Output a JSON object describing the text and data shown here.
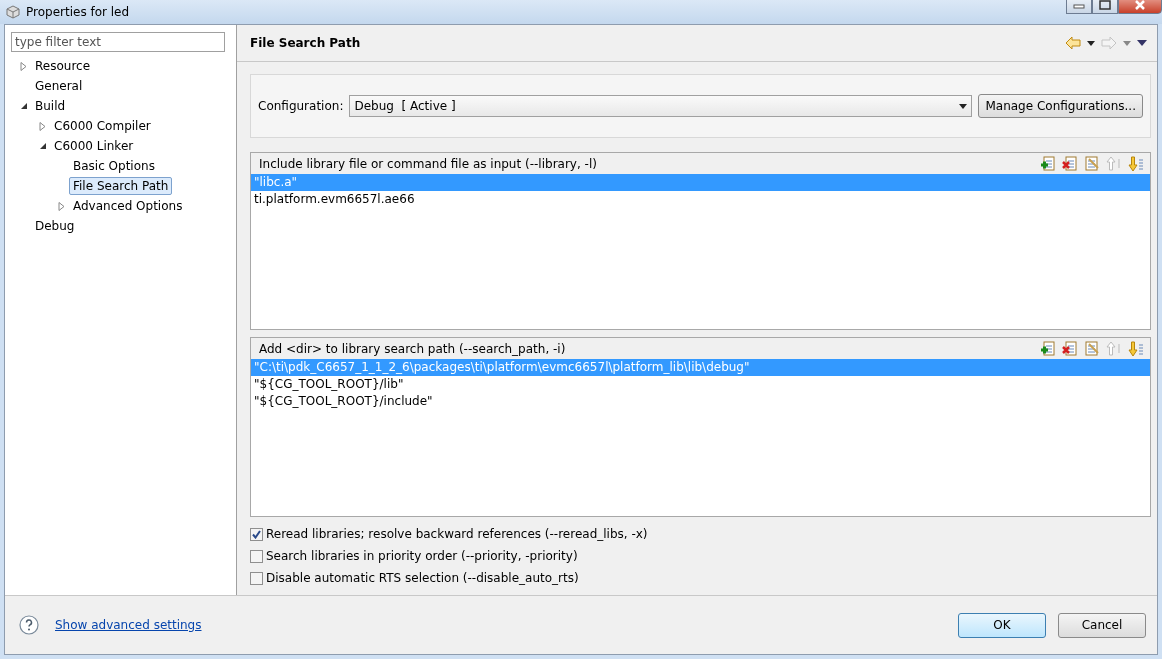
{
  "window": {
    "title": "Properties for led"
  },
  "filter": {
    "placeholder": "type filter text"
  },
  "tree": [
    {
      "label": "Resource",
      "expanded": false,
      "selected": false
    },
    {
      "label": "General",
      "selected": false
    },
    {
      "label": "Build",
      "expanded": true,
      "selected": false,
      "children": [
        {
          "label": "C6000 Compiler",
          "expanded": false,
          "selected": false
        },
        {
          "label": "C6000 Linker",
          "expanded": true,
          "selected": false,
          "children": [
            {
              "label": "Basic Options",
              "selected": false
            },
            {
              "label": "File Search Path",
              "selected": true
            },
            {
              "label": "Advanced Options",
              "expanded": false,
              "selected": false
            }
          ]
        }
      ]
    },
    {
      "label": "Debug",
      "selected": false
    }
  ],
  "page": {
    "title": "File Search Path"
  },
  "configuration": {
    "label": "Configuration:",
    "value": "Debug  [ Active ]",
    "button": "Manage Configurations..."
  },
  "lists": [
    {
      "title": "Include library file or command file as input (--library, -l)",
      "items": [
        {
          "text": "\"libc.a\"",
          "selected": true
        },
        {
          "text": "ti.platform.evm6657l.ae66",
          "selected": false
        }
      ]
    },
    {
      "title": "Add <dir> to library search path (--search_path, -i)",
      "items": [
        {
          "text": "\"C:\\ti\\pdk_C6657_1_1_2_6\\packages\\ti\\platform\\evmc6657l\\platform_lib\\lib\\debug\"",
          "selected": true
        },
        {
          "text": "\"${CG_TOOL_ROOT}/lib\"",
          "selected": false
        },
        {
          "text": "\"${CG_TOOL_ROOT}/include\"",
          "selected": false
        }
      ]
    }
  ],
  "options": [
    {
      "label": "Reread libraries; resolve backward references (--reread_libs, -x)",
      "checked": true
    },
    {
      "label": "Search libraries in priority order (--priority, -priority)",
      "checked": false
    },
    {
      "label": "Disable automatic RTS selection (--disable_auto_rts)",
      "checked": false
    }
  ],
  "footer": {
    "help_link": "Show advanced settings",
    "buttons": [
      {
        "label": "OK",
        "default": true
      },
      {
        "label": "Cancel",
        "default": false
      }
    ]
  }
}
